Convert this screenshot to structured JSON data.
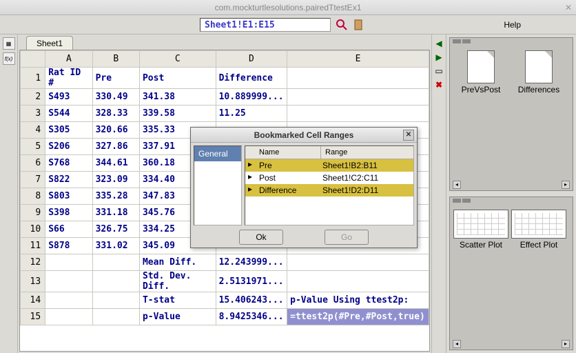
{
  "window": {
    "title": "com.mockturtlesolutions.pairedTtestEx1"
  },
  "toolbar": {
    "cellref": "Sheet1!E1:E15",
    "help": "Help"
  },
  "sheetTab": "Sheet1",
  "columns": [
    "A",
    "B",
    "C",
    "D",
    "E"
  ],
  "rows": [
    {
      "n": 1,
      "A": "Rat ID #",
      "B": "Pre",
      "C": "Post",
      "D": "Difference",
      "E": ""
    },
    {
      "n": 2,
      "A": "S493",
      "B": "330.49",
      "C": "341.38",
      "D": "10.889999...",
      "E": ""
    },
    {
      "n": 3,
      "A": "S544",
      "B": "328.33",
      "C": "339.58",
      "D": "11.25",
      "E": ""
    },
    {
      "n": 4,
      "A": "S305",
      "B": "320.66",
      "C": "335.33",
      "D": "",
      "E": ""
    },
    {
      "n": 5,
      "A": "S206",
      "B": "327.86",
      "C": "337.91",
      "D": "",
      "E": ""
    },
    {
      "n": 6,
      "A": "S768",
      "B": "344.61",
      "C": "360.18",
      "D": "",
      "E": ""
    },
    {
      "n": 7,
      "A": "S822",
      "B": "323.09",
      "C": "334.40",
      "D": "",
      "E": ""
    },
    {
      "n": 8,
      "A": "S803",
      "B": "335.28",
      "C": "347.83",
      "D": "",
      "E": ""
    },
    {
      "n": 9,
      "A": "S398",
      "B": "331.18",
      "C": "345.76",
      "D": "",
      "E": ""
    },
    {
      "n": 10,
      "A": "S66",
      "B": "326.75",
      "C": "334.25",
      "D": "",
      "E": ""
    },
    {
      "n": 11,
      "A": "S878",
      "B": "331.02",
      "C": "345.09",
      "D": "",
      "E": ""
    },
    {
      "n": 12,
      "A": "",
      "B": "",
      "C": "Mean Diff.",
      "D": "12.243999...",
      "E": ""
    },
    {
      "n": 13,
      "A": "",
      "B": "",
      "C": "Std. Dev. Diff.",
      "D": "2.5131971...",
      "E": ""
    },
    {
      "n": 14,
      "A": "",
      "B": "",
      "C": "T-stat",
      "D": "15.406243...",
      "E": "p-Value Using ttest2p:"
    },
    {
      "n": 15,
      "A": "",
      "B": "",
      "C": "p-Value",
      "D": "8.9425346...",
      "E": "=ttest2p(#Pre,#Post,true)"
    }
  ],
  "dialog": {
    "title": "Bookmarked Cell Ranges",
    "category": "General",
    "nameHdr": "Name",
    "rangeHdr": "Range",
    "items": [
      {
        "name": "Pre",
        "range": "Sheet1!B2:B11",
        "sel": true
      },
      {
        "name": "Post",
        "range": "Sheet1!C2:C11",
        "sel": false
      },
      {
        "name": "Difference",
        "range": "Sheet1!D2:D11",
        "sel": true
      }
    ],
    "ok": "Ok",
    "go": "Go"
  },
  "rightTop": [
    {
      "label": "PreVsPost"
    },
    {
      "label": "Differences"
    }
  ],
  "rightBottom": [
    {
      "label": "Scatter Plot"
    },
    {
      "label": "Effect Plot"
    }
  ]
}
